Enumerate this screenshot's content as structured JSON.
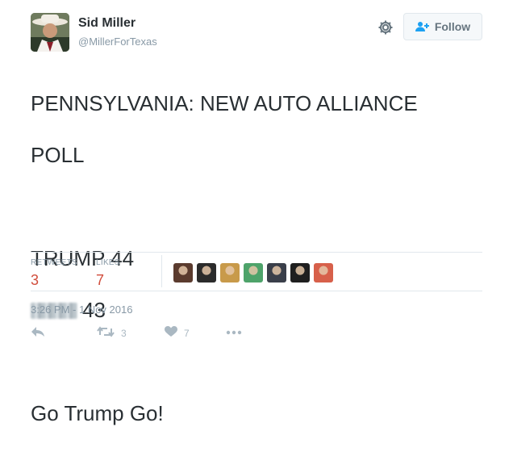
{
  "user": {
    "display_name": "Sid Miller",
    "handle": "@MillerForTexas",
    "avatar_icon": "user-avatar"
  },
  "header": {
    "settings_icon": "gear-icon",
    "follow_label": "Follow",
    "follow_icon": "add-user-icon"
  },
  "tweet": {
    "line1": "PENNSYLVANIA: NEW AUTO ALLIANCE",
    "line2": "POLL",
    "line3": "TRUMP 44",
    "line4_value": "43",
    "line5": "Go Trump Go!"
  },
  "stats": {
    "retweets_label": "RETWEETS",
    "retweets_count": "3",
    "likes_label": "LIKES",
    "likes_count": "7"
  },
  "likers": [
    {
      "name": "liker-avatar-1",
      "color": "#5b3b2e"
    },
    {
      "name": "liker-avatar-2",
      "color": "#2b2b2b"
    },
    {
      "name": "liker-avatar-3",
      "color": "#c89a4a"
    },
    {
      "name": "liker-avatar-4",
      "color": "#4ea36a"
    },
    {
      "name": "liker-avatar-5",
      "color": "#3a3f4a"
    },
    {
      "name": "liker-avatar-6",
      "color": "#1f1f1f"
    },
    {
      "name": "liker-avatar-7",
      "color": "#d7604a"
    }
  ],
  "timestamp": "3:26 PM - 1 Nov 2016",
  "actions": {
    "reply_icon": "reply-icon",
    "retweet_icon": "retweet-icon",
    "retweet_count": "3",
    "like_icon": "heart-icon",
    "like_count": "7",
    "more_icon": "more-icon"
  },
  "colors": {
    "accent": "#d14d3c",
    "muted": "#8899a6",
    "action": "#aab8c2",
    "follow_icon": "#1da1f2"
  }
}
